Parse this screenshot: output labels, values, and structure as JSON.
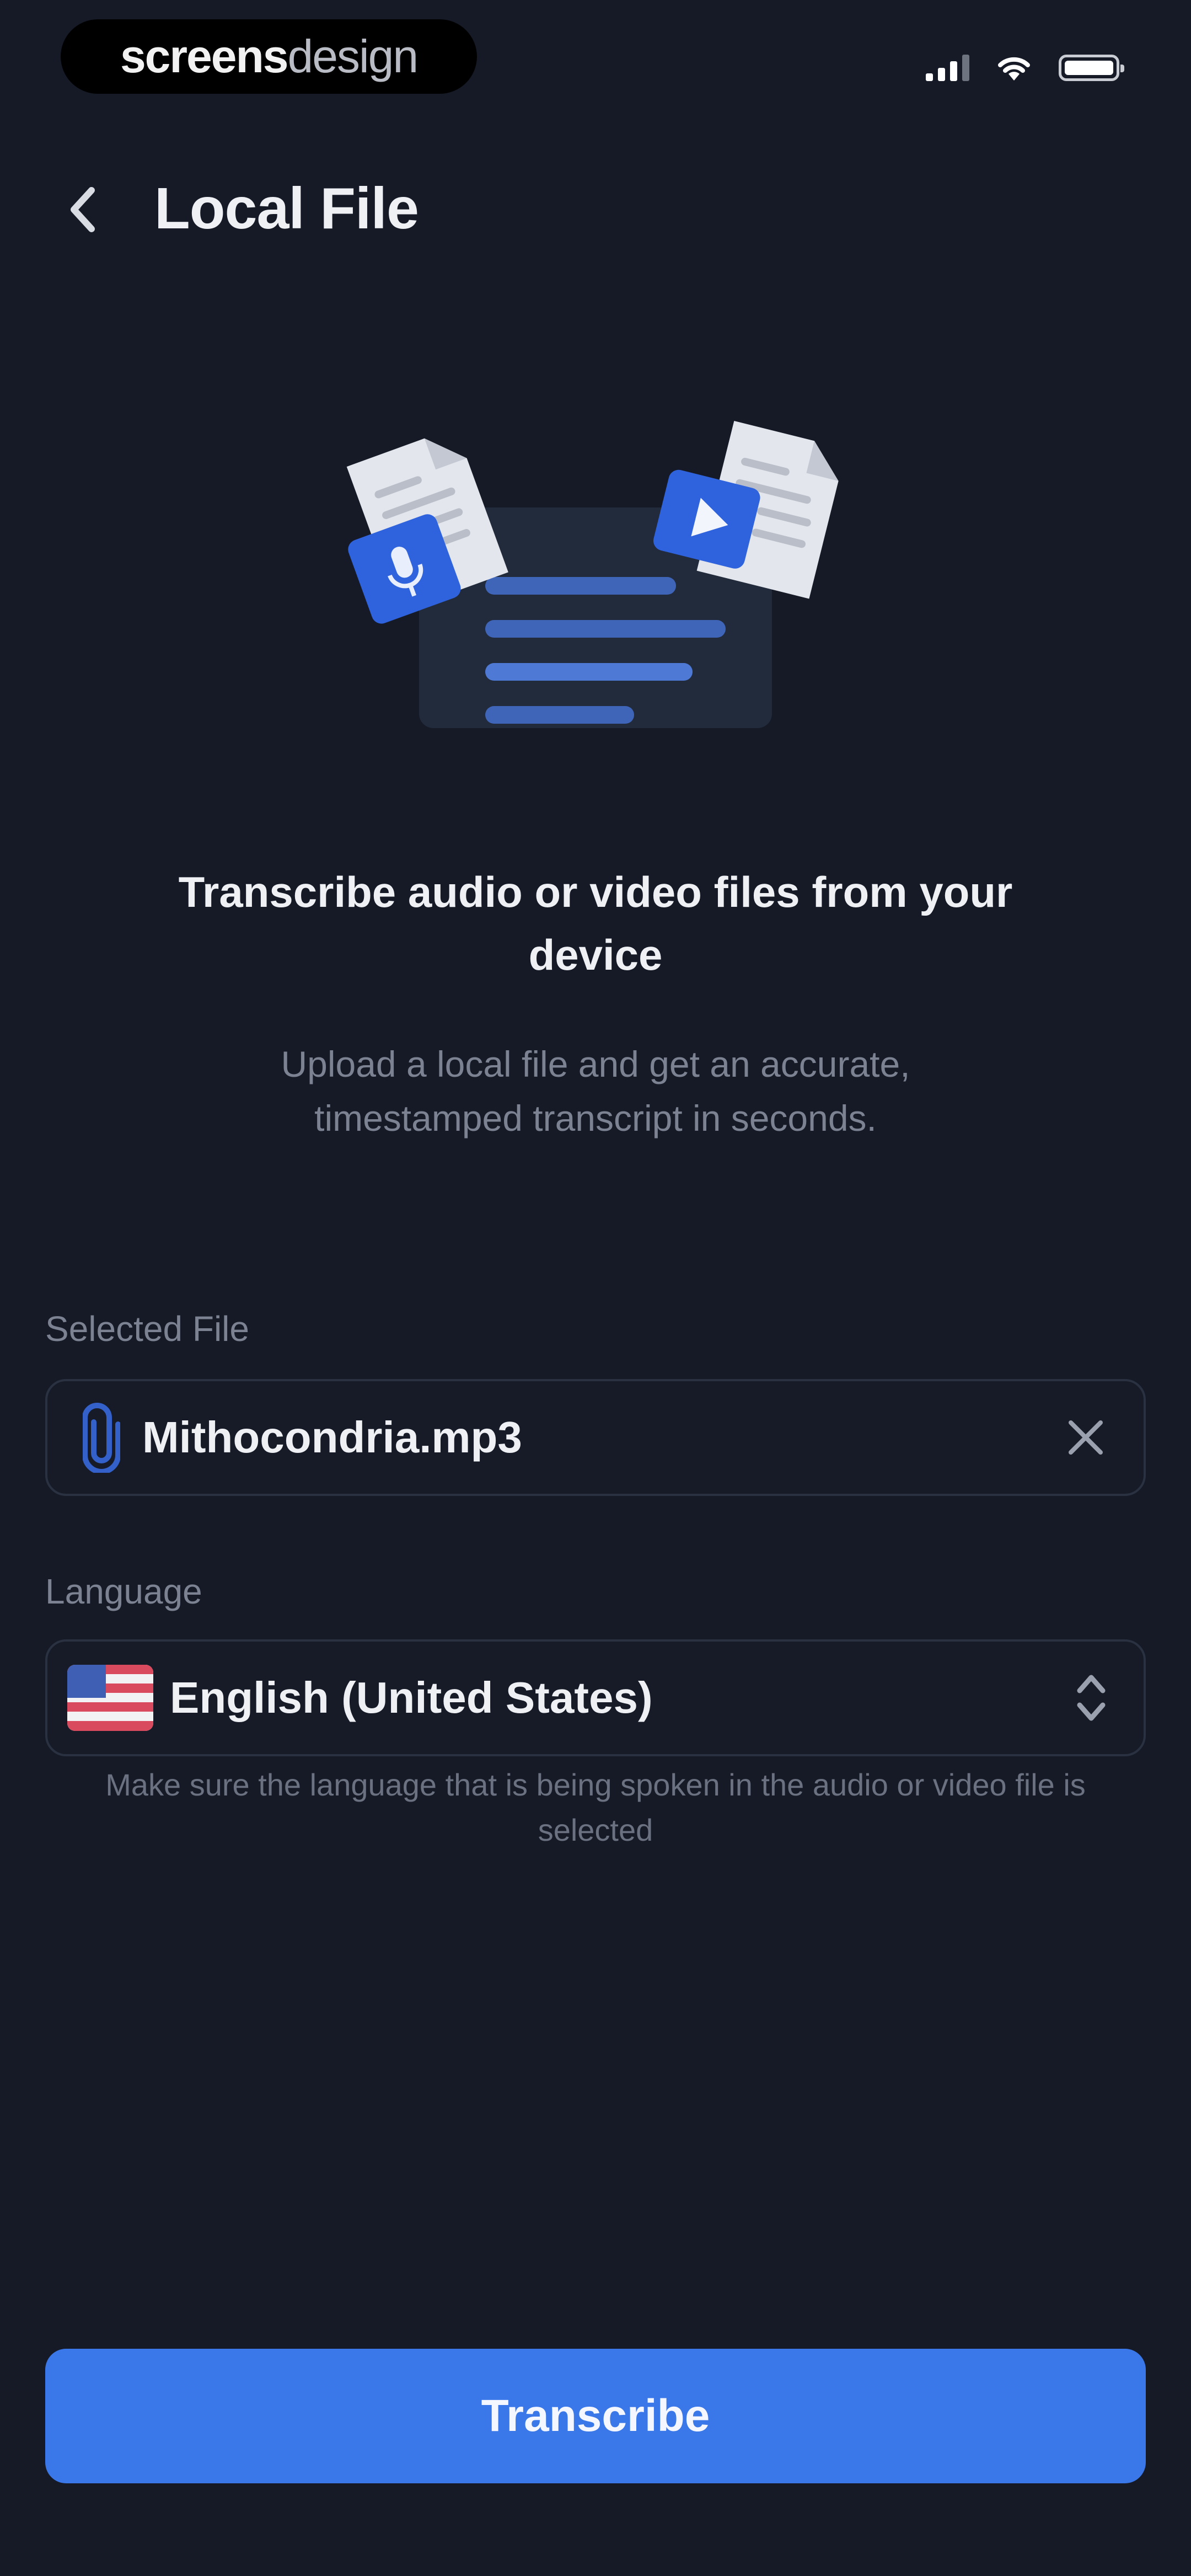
{
  "status_bar": {
    "brand_primary": "screens",
    "brand_secondary": "design",
    "signal_icon": "cellular-signal-icon",
    "wifi_icon": "wifi-icon",
    "battery_icon": "battery-icon"
  },
  "header": {
    "back_icon": "chevron-left-icon",
    "title": "Local File"
  },
  "illustration": {
    "left_doc_icon": "audio-file-icon",
    "right_doc_icon": "video-file-icon",
    "center_card": "transcript-card"
  },
  "intro": {
    "headline": "Transcribe audio or video files from your device",
    "subtext": "Upload a local file and get an accurate, timestamped transcript in seconds."
  },
  "file_field": {
    "label": "Selected File",
    "value": "Mithocondria.mp3",
    "icon": "paperclip-icon",
    "clear_icon": "close-icon"
  },
  "language_field": {
    "label": "Language",
    "value": "English (United States)",
    "flag_icon": "us-flag-icon",
    "selector_icon": "chevron-up-down-icon",
    "hint": "Make sure the language that is being spoken in the audio or video file is selected"
  },
  "actions": {
    "transcribe_label": "Transcribe"
  },
  "colors": {
    "background": "#151a26",
    "accent": "#3a77e8",
    "field_border": "#2a3141",
    "muted_text": "#7c8292"
  }
}
